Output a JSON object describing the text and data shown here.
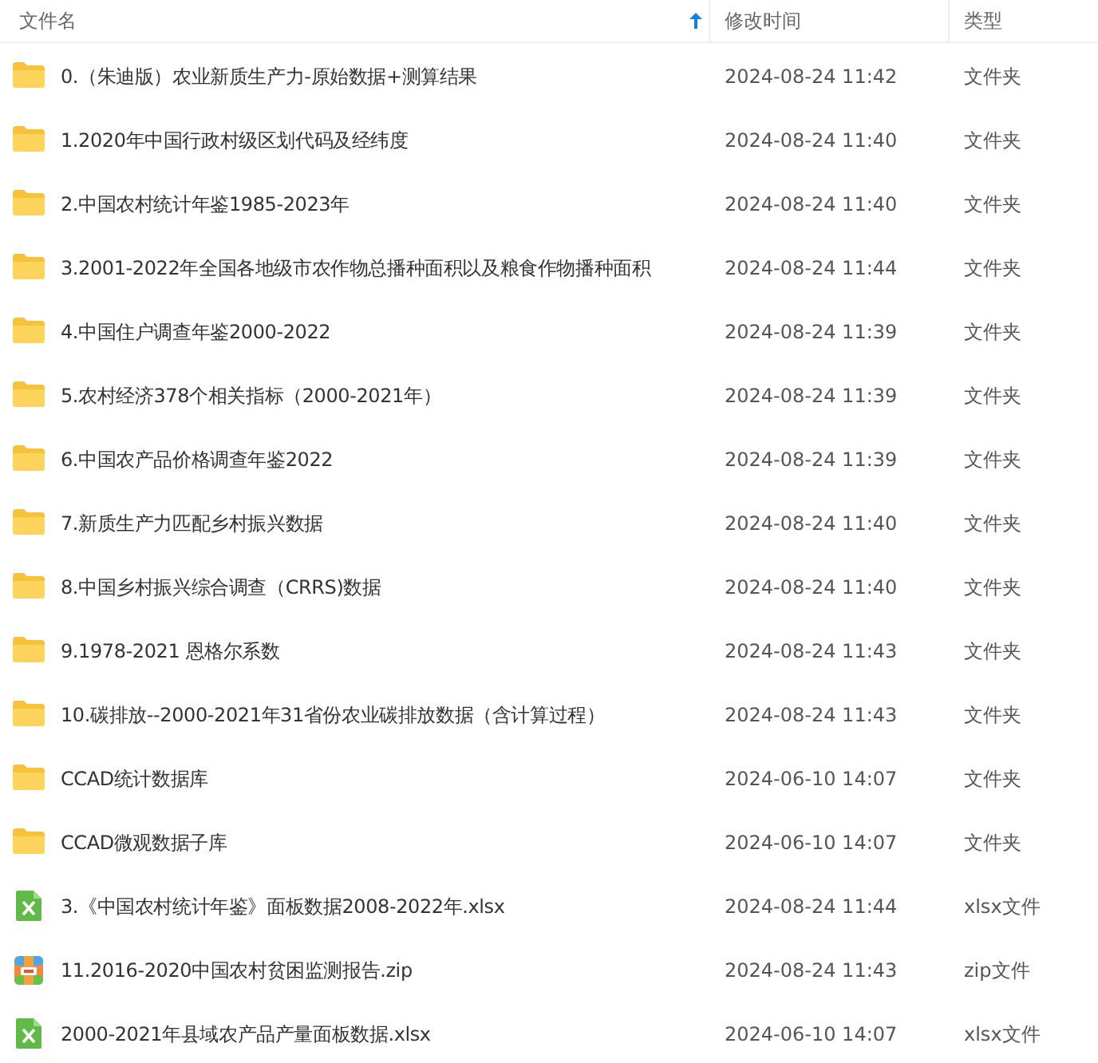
{
  "columns": [
    {
      "label": "文件名",
      "sorted": true
    },
    {
      "label": "修改时间",
      "sorted": false
    },
    {
      "label": "类型",
      "sorted": false
    }
  ],
  "rows": [
    {
      "kind": "folder",
      "name": "0.（朱迪版）农业新质生产力-原始数据+测算结果",
      "modified": "2024-08-24 11:42",
      "type": "文件夹"
    },
    {
      "kind": "folder",
      "name": "1.2020年中国行政村级区划代码及经纬度",
      "modified": "2024-08-24 11:40",
      "type": "文件夹"
    },
    {
      "kind": "folder",
      "name": "2.中国农村统计年鉴1985-2023年",
      "modified": "2024-08-24 11:40",
      "type": "文件夹"
    },
    {
      "kind": "folder",
      "name": "3.2001-2022年全国各地级市农作物总播种面积以及粮食作物播种面积",
      "modified": "2024-08-24 11:44",
      "type": "文件夹"
    },
    {
      "kind": "folder",
      "name": "4.中国住户调查年鉴2000-2022",
      "modified": "2024-08-24 11:39",
      "type": "文件夹"
    },
    {
      "kind": "folder",
      "name": "5.农村经济378个相关指标（2000-2021年）",
      "modified": "2024-08-24 11:39",
      "type": "文件夹"
    },
    {
      "kind": "folder",
      "name": "6.中国农产品价格调查年鉴2022",
      "modified": "2024-08-24 11:39",
      "type": "文件夹"
    },
    {
      "kind": "folder",
      "name": "7.新质生产力匹配乡村振兴数据",
      "modified": "2024-08-24 11:40",
      "type": "文件夹"
    },
    {
      "kind": "folder",
      "name": "8.中国乡村振兴综合调查（CRRS)数据",
      "modified": "2024-08-24 11:40",
      "type": "文件夹"
    },
    {
      "kind": "folder",
      "name": "9.1978-2021 恩格尔系数",
      "modified": "2024-08-24 11:43",
      "type": "文件夹"
    },
    {
      "kind": "folder",
      "name": "10.碳排放--2000-2021年31省份农业碳排放数据（含计算过程）",
      "modified": "2024-08-24 11:43",
      "type": "文件夹"
    },
    {
      "kind": "folder",
      "name": "CCAD统计数据库",
      "modified": "2024-06-10 14:07",
      "type": "文件夹"
    },
    {
      "kind": "folder",
      "name": "CCAD微观数据子库",
      "modified": "2024-06-10 14:07",
      "type": "文件夹"
    },
    {
      "kind": "xlsx",
      "name": "3.《中国农村统计年鉴》面板数据2008-2022年.xlsx",
      "modified": "2024-08-24 11:44",
      "type": "xlsx文件"
    },
    {
      "kind": "zip",
      "name": "11.2016-2020中国农村贫困监测报告.zip",
      "modified": "2024-08-24 11:43",
      "type": "zip文件"
    },
    {
      "kind": "xlsx",
      "name": "2000-2021年县域农产品产量面板数据.xlsx",
      "modified": "2024-06-10 14:07",
      "type": "xlsx文件"
    }
  ]
}
